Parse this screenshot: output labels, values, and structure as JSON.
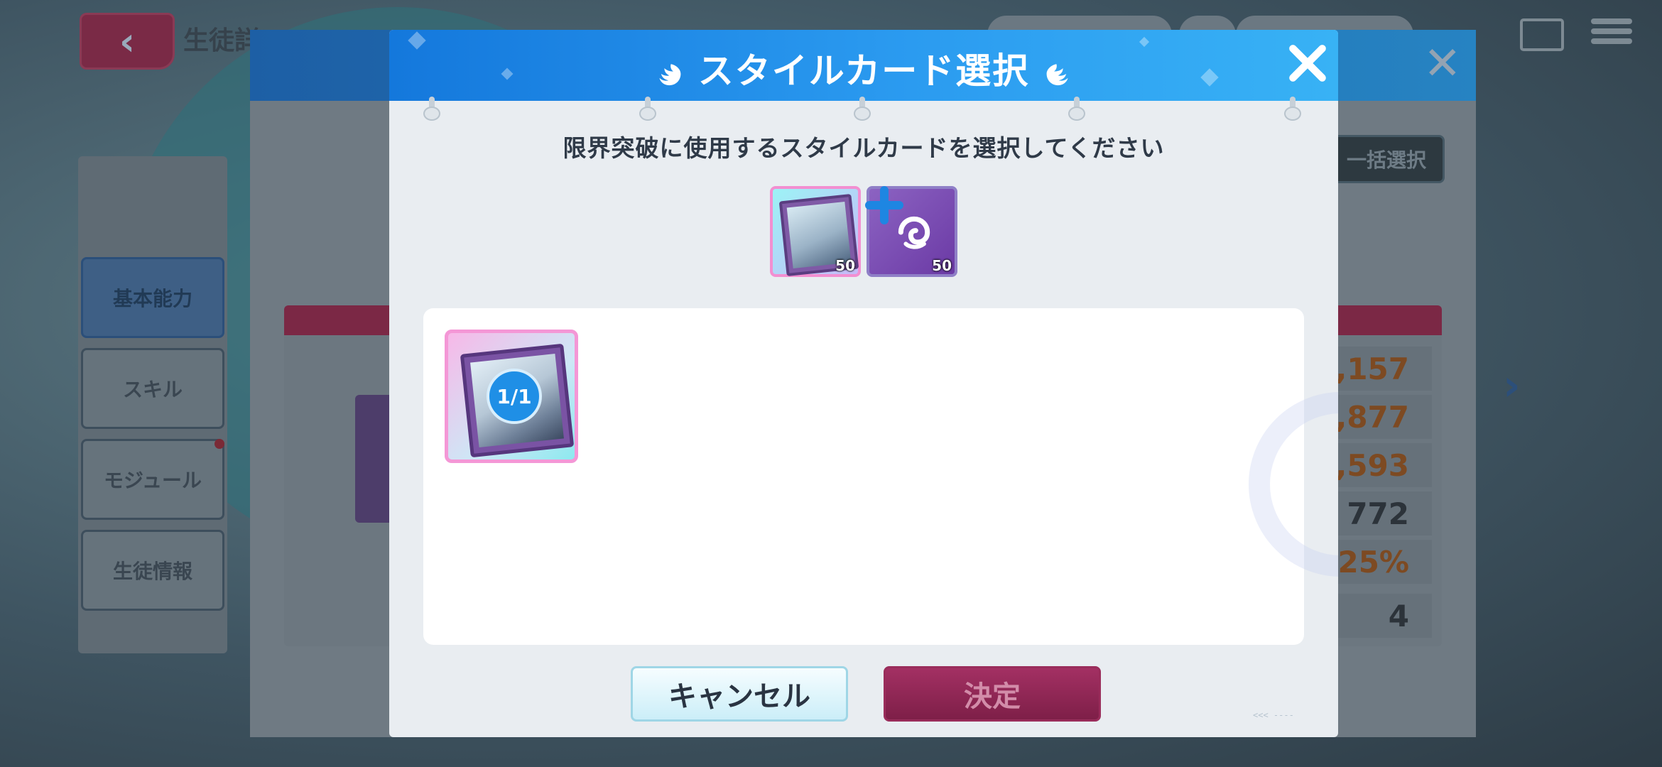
{
  "background": {
    "page_title": "生徒詳",
    "side_menu": [
      {
        "label": "基本能力"
      },
      {
        "label": "スキル"
      },
      {
        "label": "モジュール"
      },
      {
        "label": "生徒情報"
      }
    ],
    "bulk_select": "一括選択",
    "stats": [
      ",157",
      ",877",
      ",593",
      "772",
      "25%",
      "4"
    ]
  },
  "dialog": {
    "title": "スタイルカード選択",
    "instruction": "限界突破に使用するスタイルカードを選択してください",
    "mini_cards": [
      {
        "count": "50"
      },
      {
        "count": "50"
      }
    ],
    "selected_card": {
      "badge": "1/1"
    },
    "cancel_label": "キャンセル",
    "confirm_label": "決定"
  },
  "colors": {
    "header_blue": "#1478dc",
    "confirm_red": "#8a2350",
    "badge_blue": "#1f8fe6"
  },
  "icons": [
    "back-arrow-icon",
    "mail-icon",
    "menu-icon",
    "close-icon",
    "wing-icon",
    "plus-icon",
    "chevron-right-icon"
  ]
}
